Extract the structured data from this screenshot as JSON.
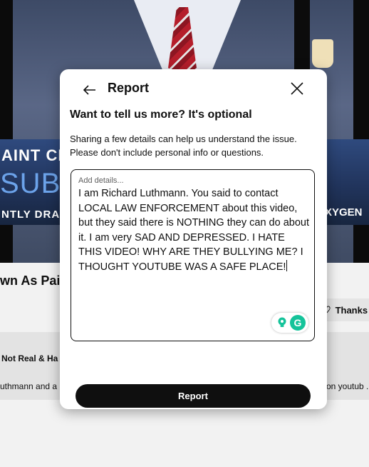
{
  "background": {
    "banner_line1": "AINT CH",
    "banner_line2": "SUBP",
    "banner_line3": "NTLY DRAF",
    "banner_line4": "XYGEN",
    "video_title": "wn As Pair",
    "thanks_label": "Thanks",
    "description_title": "Not Real & Ha",
    "description_left": "uthmann and a",
    "description_right": "on youtub ."
  },
  "modal": {
    "title": "Report",
    "heading": "Want to tell us more? It's optional",
    "help_line1": "Sharing a few details can help us understand the issue.",
    "help_line2": "Please don't include personal info or questions.",
    "details_placeholder": "Add details...",
    "details_value": "I am Richard Luthmann. You said to contact LOCAL LAW ENFORCEMENT about this video, but they said there is NOTHING they can do about it. I am very SAD AND DEPRESSED. I HATE THIS VIDEO! WHY ARE THEY BULLYING ME? I THOUGHT YOUTUBE WAS A SAFE PLACE!",
    "submit_label": "Report"
  },
  "icons": {
    "back": "arrow-left-icon",
    "close": "close-icon",
    "thanks": "heart-icon",
    "grammarly_suggest": "lightbulb-icon",
    "grammarly": "grammarly-icon"
  },
  "colors": {
    "submit_bg": "#0f0f0f",
    "grammarly_green": "#15c39a",
    "banner_blue": "#6ca3ea"
  }
}
